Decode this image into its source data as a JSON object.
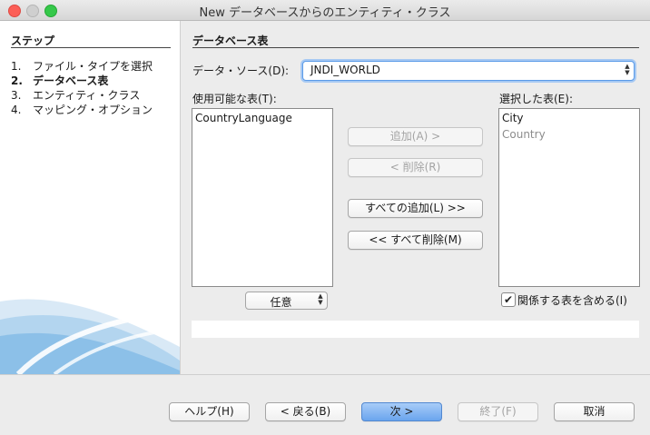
{
  "window": {
    "title": "New データベースからのエンティティ・クラス"
  },
  "steps": {
    "title": "ステップ",
    "items": [
      {
        "num": "1.",
        "label": "ファイル・タイプを選択",
        "active": false
      },
      {
        "num": "2.",
        "label": "データベース表",
        "active": true
      },
      {
        "num": "3.",
        "label": "エンティティ・クラス",
        "active": false
      },
      {
        "num": "4.",
        "label": "マッピング・オプション",
        "active": false
      }
    ]
  },
  "panel": {
    "title": "データベース表",
    "datasource_label": "データ・ソース(D):",
    "datasource_value": "JNDI_WORLD",
    "available_label": "使用可能な表(T):",
    "selected_label": "選択した表(E):",
    "available_tables": [
      "CountryLanguage"
    ],
    "selected_tables": [
      {
        "name": "City",
        "dim": false
      },
      {
        "name": "Country",
        "dim": true
      }
    ],
    "filter_value": "任意",
    "include_related_label": "関係する表を含める(I)",
    "include_related_checked": true
  },
  "transfer_buttons": {
    "add": "追加(A) >",
    "remove": "< 削除(R)",
    "add_all": "すべての追加(L) >>",
    "remove_all": "<< すべて削除(M)"
  },
  "footer": {
    "help": "ヘルプ(H)",
    "back": "< 戻る(B)",
    "next": "次 >",
    "finish": "終了(F)",
    "cancel": "取消"
  },
  "colors": {
    "accent": "#6aa5ee",
    "focus": "#5a9ae8",
    "close": "#fc5f57",
    "maximize": "#35c84a"
  }
}
